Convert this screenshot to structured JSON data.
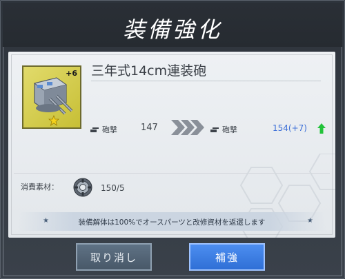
{
  "dialog": {
    "title": "装備強化"
  },
  "item": {
    "name": "三年式14cm連装砲",
    "level_badge": "+6",
    "card_color": "#d8cf3a",
    "icon": "naval-gun-turret-icon"
  },
  "stats": {
    "label": "砲撃",
    "before_value": "147",
    "after_value": "154(+7)",
    "after_color": "#3d6fd8",
    "increase_icon": "green-up-arrow-icon"
  },
  "materials": {
    "label": "消費素材：",
    "value": "150/5",
    "icon": "equipment-parts-icon"
  },
  "notice": {
    "text": "装備解体は100%でオースパーツと改修資材を返還します",
    "star_left": "★",
    "star_right": "★"
  },
  "buttons": {
    "cancel_label": "取り消し",
    "confirm_label": "補強",
    "confirm_color": "#3b7ee6"
  }
}
